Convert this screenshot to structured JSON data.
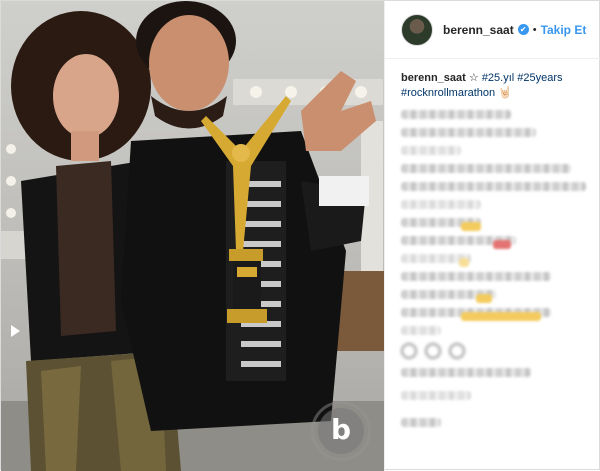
{
  "post": {
    "username": "berenn_saat",
    "follow_label": "Takip Et",
    "separator": "•",
    "verified_glyph": "✔",
    "caption_username": "berenn_saat",
    "caption_prefix": "☆",
    "caption_tags": [
      "#25.yıl",
      "#25years",
      "#rocknrollmarathon"
    ],
    "caption_emoji": "🤘🏻",
    "watermark_letter": "b"
  },
  "colors": {
    "accent": "#3897f0",
    "hashtag": "#003569",
    "text": "#262626"
  }
}
